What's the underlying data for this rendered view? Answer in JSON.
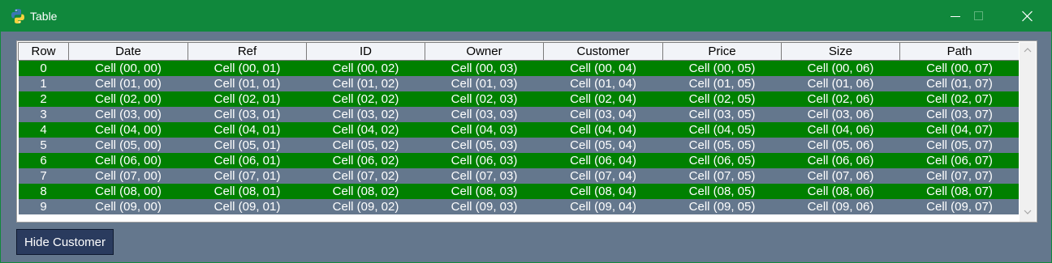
{
  "window": {
    "title": "Table",
    "titlebar_color": "#10883c",
    "background_color": "#64778d"
  },
  "icons": {
    "app": "python-icon",
    "minimize": "minimize-icon",
    "maximize": "maximize-icon",
    "close": "close-icon",
    "scroll_up": "chevron-up-icon",
    "scroll_down": "chevron-down-icon"
  },
  "table": {
    "columns": [
      "Row",
      "Date",
      "Ref",
      "ID",
      "Owner",
      "Customer",
      "Price",
      "Size",
      "Path"
    ],
    "row_colors": {
      "even": "#008000",
      "odd": "#64778d"
    },
    "rows": [
      [
        "0",
        "Cell (00, 00)",
        "Cell (00, 01)",
        "Cell (00, 02)",
        "Cell (00, 03)",
        "Cell (00, 04)",
        "Cell (00, 05)",
        "Cell (00, 06)",
        "Cell (00, 07)"
      ],
      [
        "1",
        "Cell (01, 00)",
        "Cell (01, 01)",
        "Cell (01, 02)",
        "Cell (01, 03)",
        "Cell (01, 04)",
        "Cell (01, 05)",
        "Cell (01, 06)",
        "Cell (01, 07)"
      ],
      [
        "2",
        "Cell (02, 00)",
        "Cell (02, 01)",
        "Cell (02, 02)",
        "Cell (02, 03)",
        "Cell (02, 04)",
        "Cell (02, 05)",
        "Cell (02, 06)",
        "Cell (02, 07)"
      ],
      [
        "3",
        "Cell (03, 00)",
        "Cell (03, 01)",
        "Cell (03, 02)",
        "Cell (03, 03)",
        "Cell (03, 04)",
        "Cell (03, 05)",
        "Cell (03, 06)",
        "Cell (03, 07)"
      ],
      [
        "4",
        "Cell (04, 00)",
        "Cell (04, 01)",
        "Cell (04, 02)",
        "Cell (04, 03)",
        "Cell (04, 04)",
        "Cell (04, 05)",
        "Cell (04, 06)",
        "Cell (04, 07)"
      ],
      [
        "5",
        "Cell (05, 00)",
        "Cell (05, 01)",
        "Cell (05, 02)",
        "Cell (05, 03)",
        "Cell (05, 04)",
        "Cell (05, 05)",
        "Cell (05, 06)",
        "Cell (05, 07)"
      ],
      [
        "6",
        "Cell (06, 00)",
        "Cell (06, 01)",
        "Cell (06, 02)",
        "Cell (06, 03)",
        "Cell (06, 04)",
        "Cell (06, 05)",
        "Cell (06, 06)",
        "Cell (06, 07)"
      ],
      [
        "7",
        "Cell (07, 00)",
        "Cell (07, 01)",
        "Cell (07, 02)",
        "Cell (07, 03)",
        "Cell (07, 04)",
        "Cell (07, 05)",
        "Cell (07, 06)",
        "Cell (07, 07)"
      ],
      [
        "8",
        "Cell (08, 00)",
        "Cell (08, 01)",
        "Cell (08, 02)",
        "Cell (08, 03)",
        "Cell (08, 04)",
        "Cell (08, 05)",
        "Cell (08, 06)",
        "Cell (08, 07)"
      ],
      [
        "9",
        "Cell (09, 00)",
        "Cell (09, 01)",
        "Cell (09, 02)",
        "Cell (09, 03)",
        "Cell (09, 04)",
        "Cell (09, 05)",
        "Cell (09, 06)",
        "Cell (09, 07)"
      ]
    ]
  },
  "buttons": {
    "hide_customer": "Hide Customer",
    "hide_customer_bg": "#2a3b5e"
  }
}
